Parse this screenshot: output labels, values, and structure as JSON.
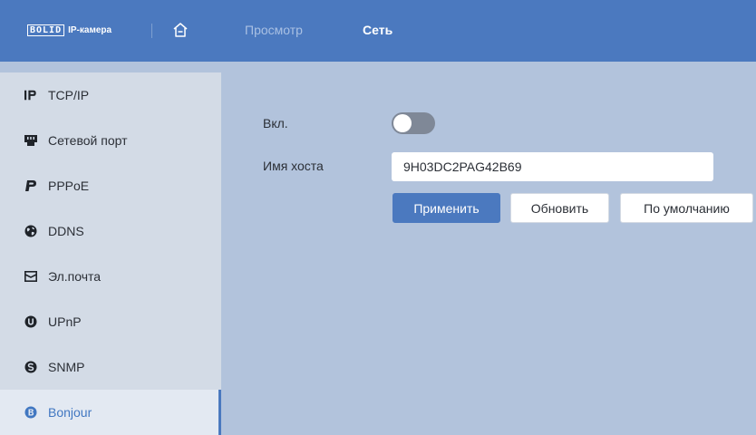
{
  "header": {
    "logo_badge": "BOLID",
    "logo_text": "IP-камера",
    "nav": [
      {
        "label": "Просмотр"
      },
      {
        "label": "Сеть"
      }
    ]
  },
  "sidebar": {
    "items": [
      {
        "label": "TCP/IP",
        "icon": "ip-icon"
      },
      {
        "label": "Сетевой порт",
        "icon": "ethernet-port-icon"
      },
      {
        "label": "PPPoE",
        "icon": "pppoe-icon"
      },
      {
        "label": "DDNS",
        "icon": "globe-icon"
      },
      {
        "label": "Эл.почта",
        "icon": "envelope-icon"
      },
      {
        "label": "UPnP",
        "icon": "upnp-icon"
      },
      {
        "label": "SNMP",
        "icon": "snmp-icon"
      },
      {
        "label": "Bonjour",
        "icon": "bonjour-icon",
        "active": true
      }
    ]
  },
  "form": {
    "enable_label": "Вкл.",
    "enable_on": false,
    "hostname_label": "Имя хоста",
    "hostname_value": "9H03DC2PAG42B69"
  },
  "buttons": {
    "apply": "Применить",
    "refresh": "Обновить",
    "default": "По умолчанию"
  },
  "colors": {
    "accent": "#4b79bf",
    "sidebar_bg": "#d3dbe6",
    "content_bg": "#b2c3dc",
    "toggle_off": "#7f8897"
  }
}
